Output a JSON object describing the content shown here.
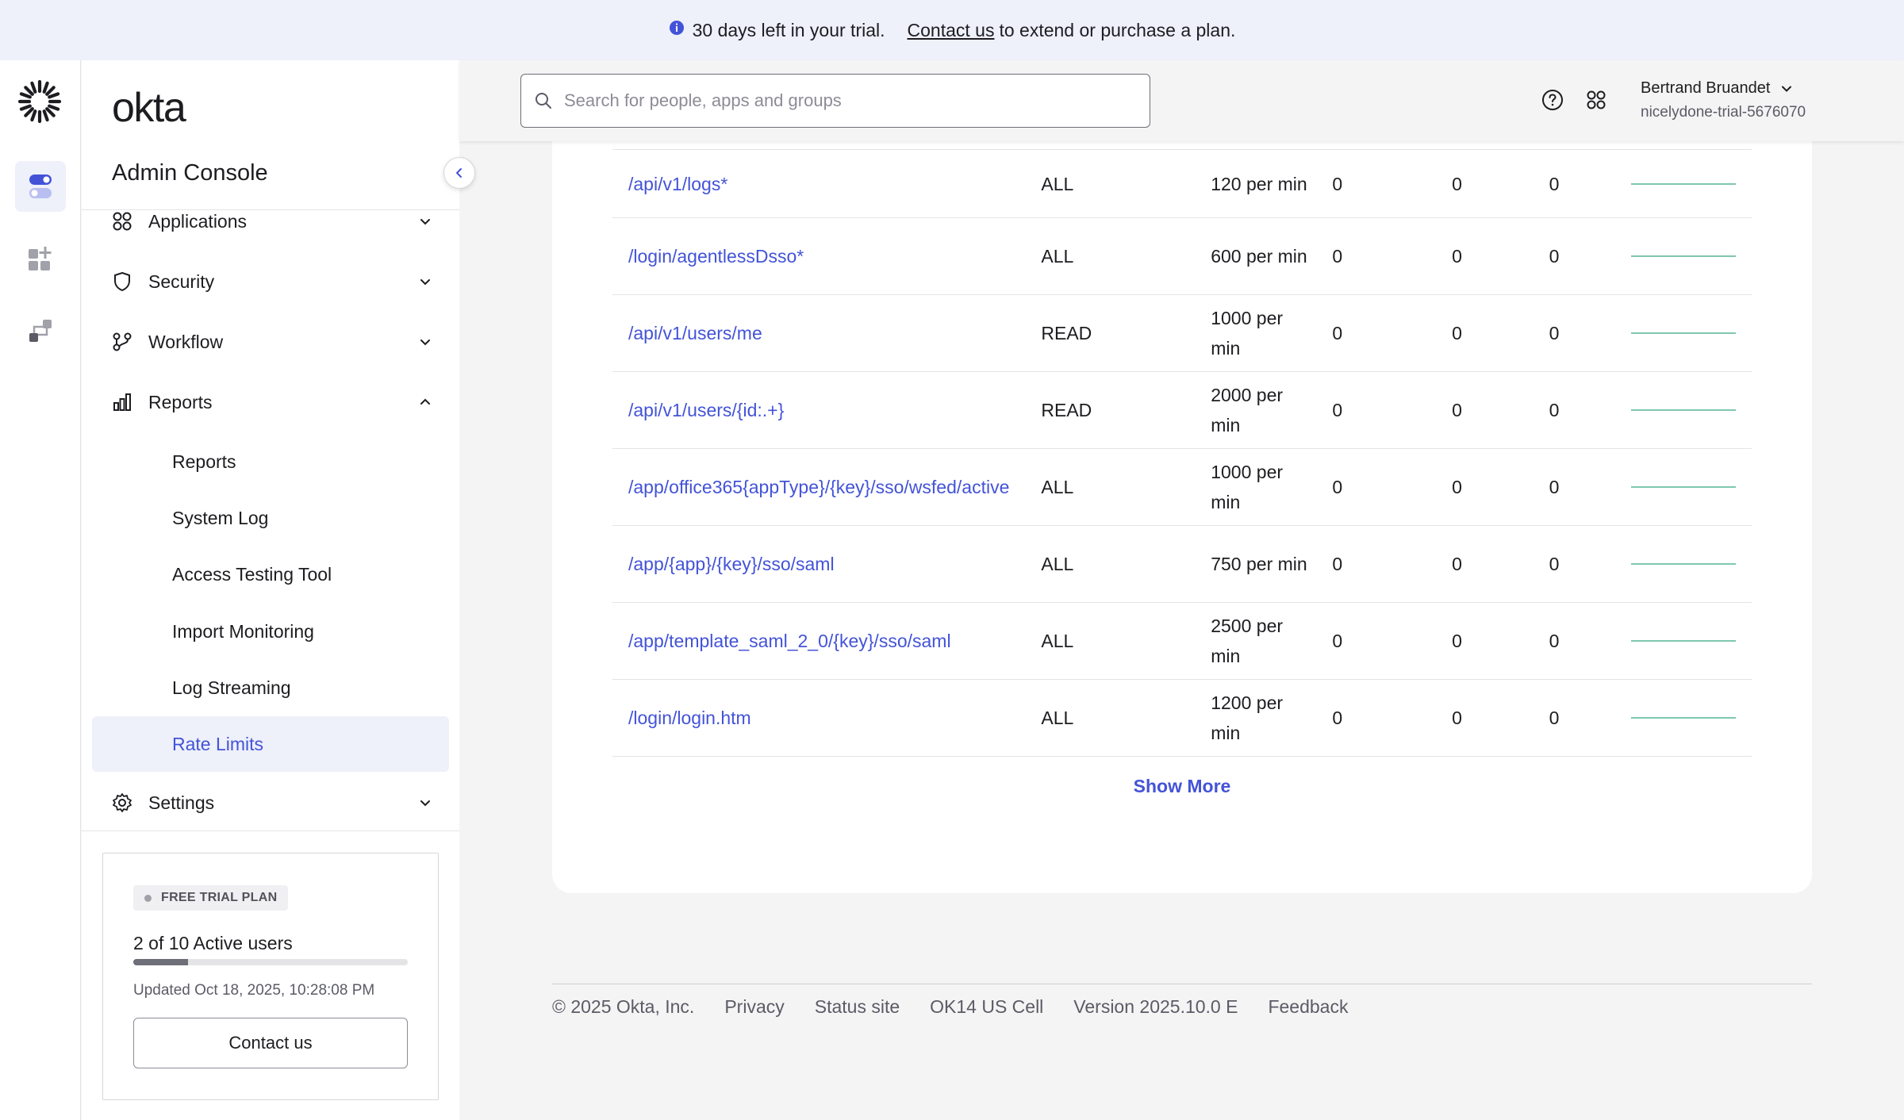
{
  "banner": {
    "message": "30 days left in your trial.",
    "link": "Contact us",
    "suffix": "to extend or purchase a plan."
  },
  "brand": {
    "logo_text": "okta",
    "console_title": "Admin Console"
  },
  "nav": {
    "applications": "Applications",
    "security": "Security",
    "workflow": "Workflow",
    "reports": "Reports",
    "settings": "Settings",
    "reports_sub": [
      "Reports",
      "System Log",
      "Access Testing Tool",
      "Import Monitoring",
      "Log Streaming",
      "Rate Limits"
    ],
    "active_sub": "Rate Limits"
  },
  "trial": {
    "badge": "FREE TRIAL PLAN",
    "users": "2 of 10 Active users",
    "users_active": 2,
    "users_total": 10,
    "updated": "Updated Oct 18, 2025, 10:28:08 PM",
    "contact_button": "Contact us"
  },
  "header": {
    "search_placeholder": "Search for people, apps and groups",
    "user_name": "Bertrand Bruandet",
    "user_org": "nicelydone-trial-5676070"
  },
  "rate_limits": {
    "rows": [
      {
        "endpoint": "/api/v1/logs*",
        "method": "ALL",
        "limit": "120 per min",
        "c1": "0",
        "c2": "0",
        "c3": "0"
      },
      {
        "endpoint": "/login/agentlessDsso*",
        "method": "ALL",
        "limit": "600 per min",
        "c1": "0",
        "c2": "0",
        "c3": "0"
      },
      {
        "endpoint": "/api/v1/users/me",
        "method": "READ",
        "limit": "1000 per min",
        "c1": "0",
        "c2": "0",
        "c3": "0"
      },
      {
        "endpoint": "/api/v1/users/{id:.+}",
        "method": "READ",
        "limit": "2000 per min",
        "c1": "0",
        "c2": "0",
        "c3": "0"
      },
      {
        "endpoint": "/app/office365{appType}/{key}/sso/wsfed/active",
        "method": "ALL",
        "limit": "1000 per min",
        "c1": "0",
        "c2": "0",
        "c3": "0"
      },
      {
        "endpoint": "/app/{app}/{key}/sso/saml",
        "method": "ALL",
        "limit": "750 per min",
        "c1": "0",
        "c2": "0",
        "c3": "0"
      },
      {
        "endpoint": "/app/template_saml_2_0/{key}/sso/saml",
        "method": "ALL",
        "limit": "2500 per min",
        "c1": "0",
        "c2": "0",
        "c3": "0"
      },
      {
        "endpoint": "/login/login.htm",
        "method": "ALL",
        "limit": "1200 per min",
        "c1": "0",
        "c2": "0",
        "c3": "0"
      }
    ],
    "show_more": "Show More"
  },
  "footer": {
    "copyright": "© 2025 Okta, Inc.",
    "privacy": "Privacy",
    "status": "Status site",
    "cell": "OK14 US Cell",
    "version": "Version 2025.10.0 E",
    "feedback": "Feedback"
  },
  "colors": {
    "accent": "#4353d8",
    "banner_bg": "#eef0fa",
    "sparkline": "#7fc7ad"
  },
  "icons": [
    "info-icon",
    "okta-logo-icon",
    "toggle-icon",
    "add-widget-icon",
    "workflow-icon",
    "chevron-left-icon",
    "applications-icon",
    "shield-icon",
    "workflow-nav-icon",
    "reports-icon",
    "gear-icon",
    "chevron-down-icon",
    "chevron-up-icon",
    "search-icon",
    "help-icon",
    "apps-grid-icon"
  ]
}
